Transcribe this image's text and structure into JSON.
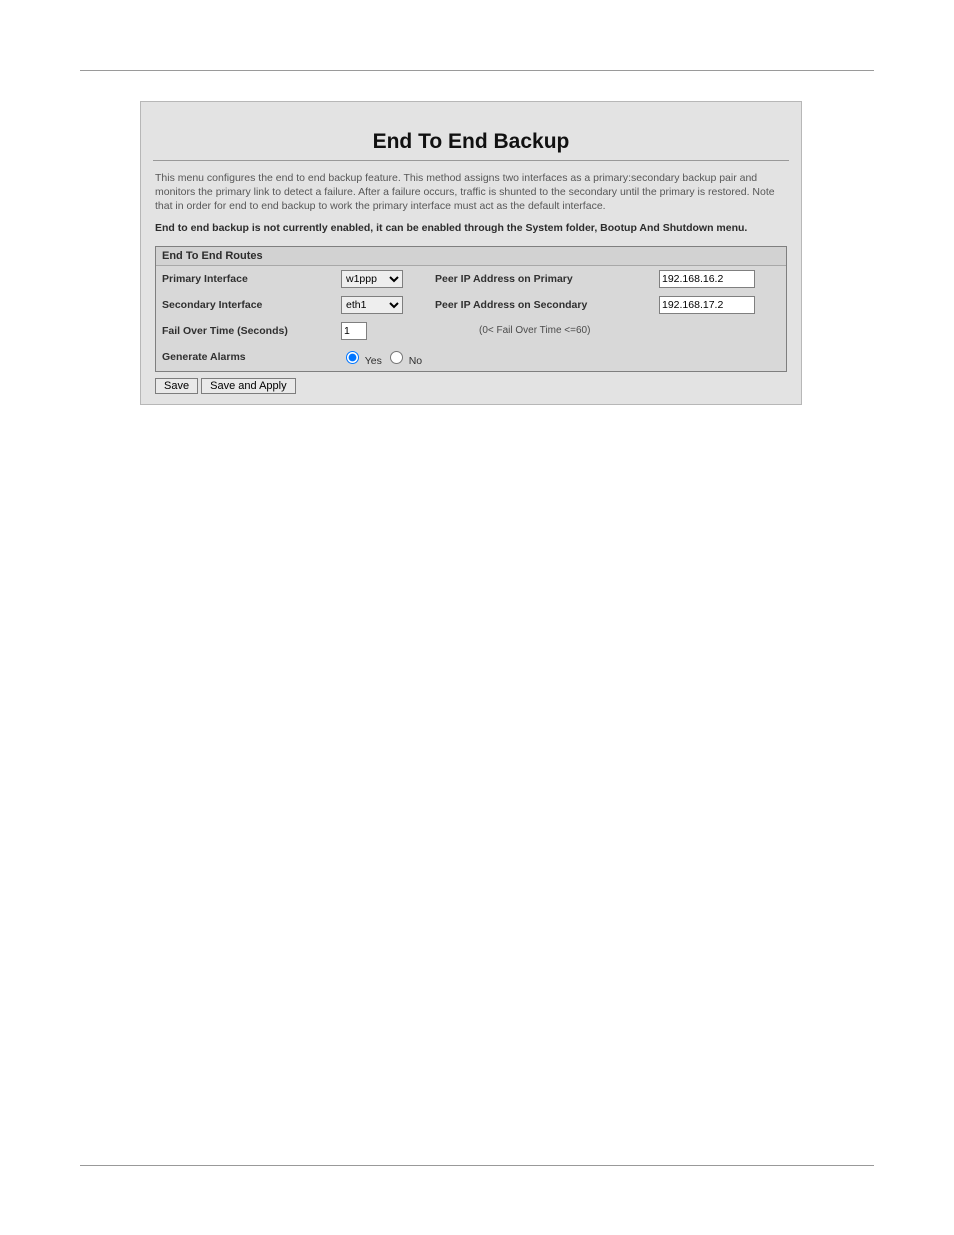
{
  "header": {
    "title": "End To End Backup",
    "intro": "This menu configures the end to end backup feature. This method assigns two interfaces as a primary:secondary backup pair and monitors the primary link to detect a failure. After a failure occurs, traffic is shunted to the secondary until the primary is restored. Note that in order for end to end backup to work the primary interface must act as the default interface.",
    "enable_note": "End to end backup is not currently enabled, it can be enabled through the System folder, Bootup And Shutdown menu."
  },
  "table": {
    "header": "End To End Routes",
    "primary_if_label": "Primary Interface",
    "primary_if_value": "w1ppp",
    "peer_primary_label": "Peer IP Address on Primary",
    "peer_primary_value": "192.168.16.2",
    "secondary_if_label": "Secondary Interface",
    "secondary_if_value": "eth1",
    "peer_secondary_label": "Peer IP Address on Secondary",
    "peer_secondary_value": "192.168.17.2",
    "failover_label": "Fail Over Time (Seconds)",
    "failover_value": "1",
    "failover_hint": "(0< Fail Over Time <=60)",
    "alarms_label": "Generate Alarms",
    "alarms_yes": "Yes",
    "alarms_no": "No",
    "alarms_selected": "yes"
  },
  "buttons": {
    "save": "Save",
    "save_apply": "Save and Apply"
  }
}
